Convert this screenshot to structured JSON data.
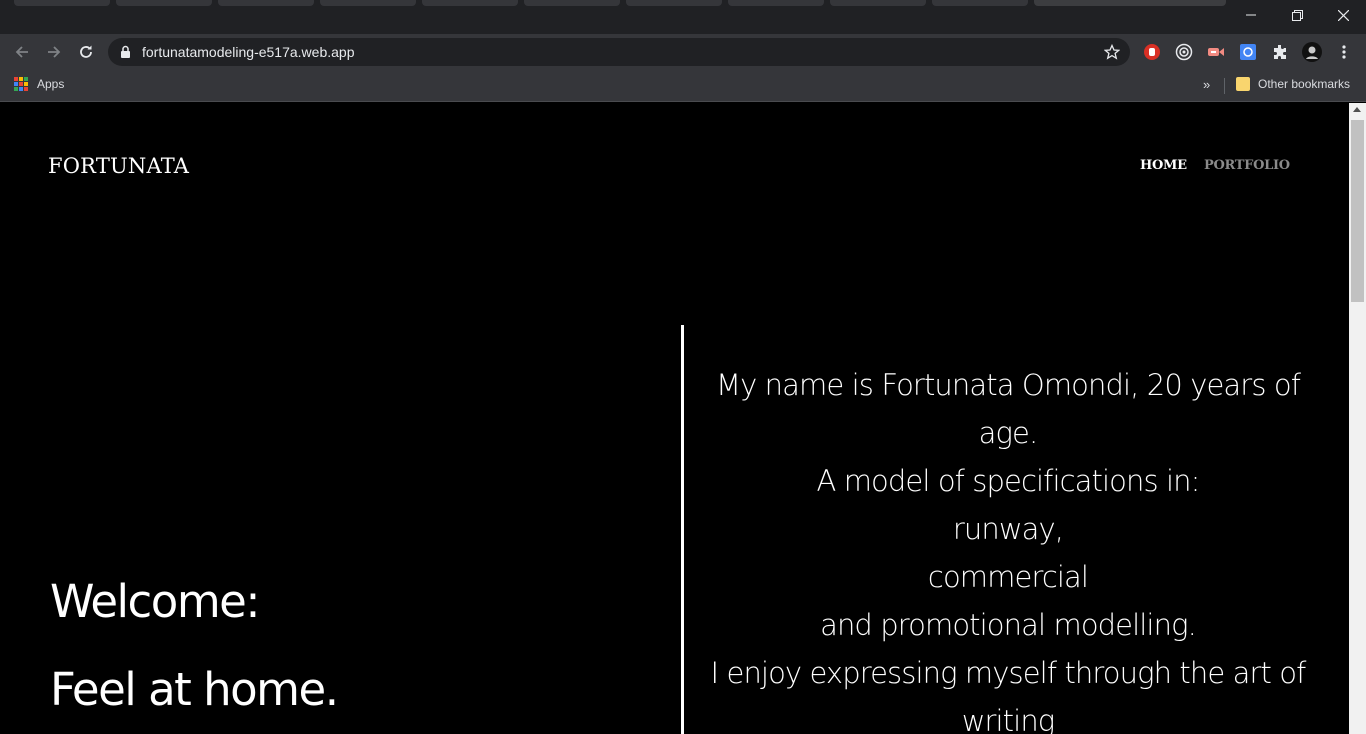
{
  "browser": {
    "url": "fortunatamodeling-e517a.web.app",
    "bookmarks": {
      "apps_label": "Apps",
      "more_label": "»",
      "other_label": "Other bookmarks"
    },
    "icons": [
      "back-icon",
      "forward-icon",
      "reload-icon",
      "lock-icon",
      "star-icon",
      "extensions-icon",
      "menu-icon",
      "minimize-icon",
      "restore-icon",
      "close-icon"
    ]
  },
  "site": {
    "brand": "FORTUNATA",
    "nav": {
      "home": "HOME",
      "portfolio": "PORTFOLIO"
    },
    "hero": {
      "welcome": "Welcome:",
      "feel": "Feel at home."
    },
    "bio": {
      "line1": "My name is Fortunata Omondi, 20 years of age.",
      "line2": "A model of specifications in:",
      "line3": "runway,",
      "line4": "commercial",
      "line5": "and promotional modelling.",
      "line6": "I enjoy expressing myself through the art of writing"
    }
  },
  "colors": {
    "background": "#000000",
    "text": "#ffffff",
    "nav_inactive": "#8a8a8a",
    "chrome_dark": "#202124",
    "chrome_toolbar": "#35363a"
  }
}
